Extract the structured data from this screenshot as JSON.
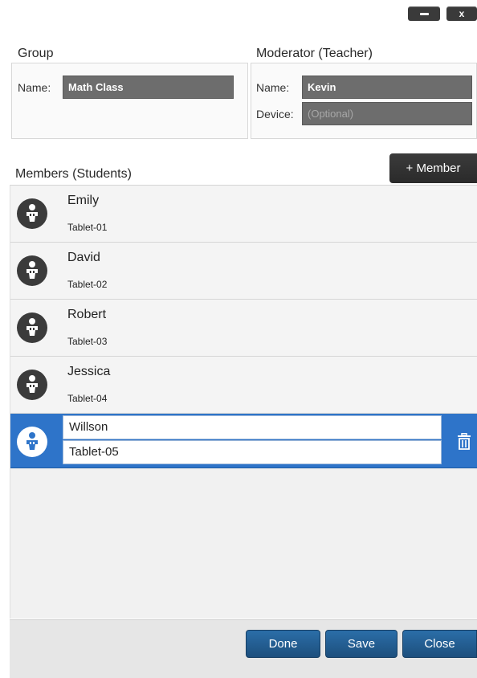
{
  "window": {
    "minimize_icon": "minimize-icon",
    "close_label": "x"
  },
  "group": {
    "title": "Group",
    "name_label": "Name:",
    "name_value": "Math Class"
  },
  "moderator": {
    "title": "Moderator (Teacher)",
    "name_label": "Name:",
    "name_value": "Kevin",
    "device_label": "Device:",
    "device_placeholder": "(Optional)"
  },
  "members": {
    "title": "Members (Students)",
    "add_label": "+ Member",
    "list": [
      {
        "name": "Emily",
        "device": "Tablet-01"
      },
      {
        "name": "David",
        "device": "Tablet-02"
      },
      {
        "name": "Robert",
        "device": "Tablet-03"
      },
      {
        "name": "Jessica",
        "device": "Tablet-04"
      },
      {
        "name": "Willson",
        "device": "Tablet-05",
        "selected": true
      }
    ]
  },
  "footer": {
    "done_label": "Done",
    "save_label": "Save",
    "close_label": "Close"
  },
  "colors": {
    "selected_row": "#2e74c9",
    "button_blue": "#1d4f7d",
    "field_bg": "#6d6d6d"
  }
}
